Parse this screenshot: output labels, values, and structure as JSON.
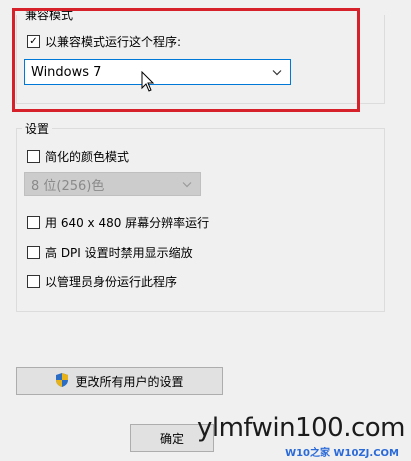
{
  "compat_group": {
    "title": "兼容模式",
    "run_compat_label": "以兼容模式运行这个程序:",
    "run_compat_checked": true,
    "os_select_value": "Windows 7"
  },
  "settings_group": {
    "title": "设置",
    "reduced_color_label": "简化的颜色模式",
    "color_select_value": "8 位(256)色",
    "res_640_label": "用 640 x 480 屏幕分辨率运行",
    "high_dpi_label": "高 DPI 设置时禁用显示缩放",
    "admin_label": "以管理员身份运行此程序"
  },
  "buttons": {
    "all_users_label": "更改所有用户的设置",
    "ok_label": "确定"
  },
  "watermark": {
    "main": "ylmfwin100.com",
    "sub": "W10之家 W10ZJ.COM"
  },
  "colors": {
    "highlight": "#d6202a",
    "select_border": "#0078d7",
    "shield_blue": "#2b6cc4",
    "shield_yellow": "#e8b21a"
  }
}
